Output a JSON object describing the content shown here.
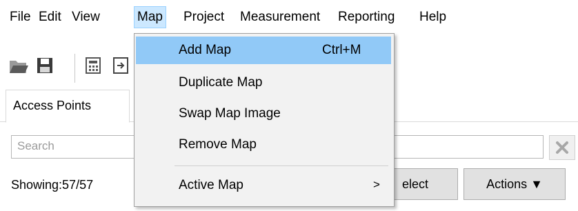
{
  "menubar": {
    "items": [
      {
        "label": "File"
      },
      {
        "label": "Edit"
      },
      {
        "label": "View"
      },
      {
        "label": "Map",
        "active": true
      },
      {
        "label": "Project"
      },
      {
        "label": "Measurement"
      },
      {
        "label": "Reporting"
      },
      {
        "label": "Help"
      }
    ]
  },
  "toolbar": {
    "icons": [
      "open-folder-icon",
      "save-icon",
      "calculator-icon",
      "import-icon"
    ]
  },
  "tabs": [
    {
      "label": "Access Points"
    }
  ],
  "search": {
    "placeholder": "Search",
    "value": ""
  },
  "status": {
    "showing": "Showing:57/57"
  },
  "buttons": {
    "select": "elect",
    "actions": "Actions ▼"
  },
  "map_menu": {
    "items": [
      {
        "label": "Add Map",
        "shortcut": "Ctrl+M",
        "highlighted": true
      },
      {
        "label": "Duplicate Map"
      },
      {
        "label": "Swap Map Image"
      },
      {
        "label": "Remove Map"
      },
      {
        "label": "Active Map",
        "submenu_arrow": ">"
      }
    ]
  },
  "colors": {
    "menu_highlight": "#91c9f7",
    "menubar_active": "#cce8ff"
  }
}
